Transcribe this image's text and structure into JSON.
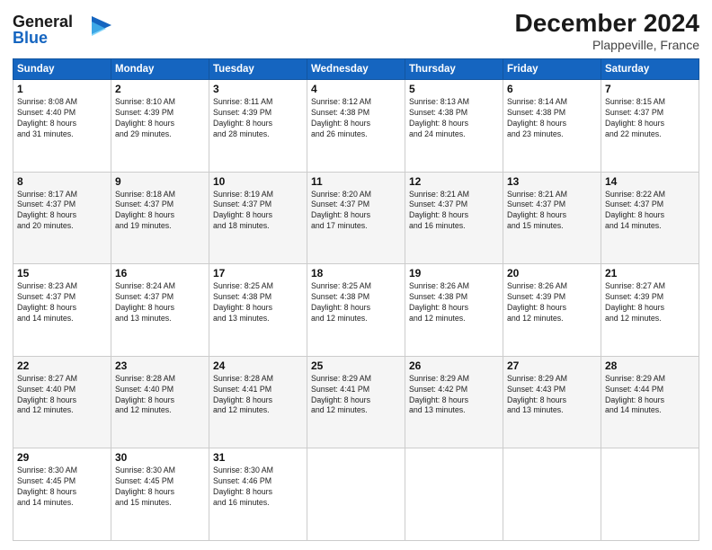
{
  "header": {
    "logo_line1": "General",
    "logo_line2": "Blue",
    "month": "December 2024",
    "location": "Plappeville, France"
  },
  "weekdays": [
    "Sunday",
    "Monday",
    "Tuesday",
    "Wednesday",
    "Thursday",
    "Friday",
    "Saturday"
  ],
  "weeks": [
    [
      {
        "day": "1",
        "info": "Sunrise: 8:08 AM\nSunset: 4:40 PM\nDaylight: 8 hours\nand 31 minutes."
      },
      {
        "day": "2",
        "info": "Sunrise: 8:10 AM\nSunset: 4:39 PM\nDaylight: 8 hours\nand 29 minutes."
      },
      {
        "day": "3",
        "info": "Sunrise: 8:11 AM\nSunset: 4:39 PM\nDaylight: 8 hours\nand 28 minutes."
      },
      {
        "day": "4",
        "info": "Sunrise: 8:12 AM\nSunset: 4:38 PM\nDaylight: 8 hours\nand 26 minutes."
      },
      {
        "day": "5",
        "info": "Sunrise: 8:13 AM\nSunset: 4:38 PM\nDaylight: 8 hours\nand 24 minutes."
      },
      {
        "day": "6",
        "info": "Sunrise: 8:14 AM\nSunset: 4:38 PM\nDaylight: 8 hours\nand 23 minutes."
      },
      {
        "day": "7",
        "info": "Sunrise: 8:15 AM\nSunset: 4:37 PM\nDaylight: 8 hours\nand 22 minutes."
      }
    ],
    [
      {
        "day": "8",
        "info": "Sunrise: 8:17 AM\nSunset: 4:37 PM\nDaylight: 8 hours\nand 20 minutes."
      },
      {
        "day": "9",
        "info": "Sunrise: 8:18 AM\nSunset: 4:37 PM\nDaylight: 8 hours\nand 19 minutes."
      },
      {
        "day": "10",
        "info": "Sunrise: 8:19 AM\nSunset: 4:37 PM\nDaylight: 8 hours\nand 18 minutes."
      },
      {
        "day": "11",
        "info": "Sunrise: 8:20 AM\nSunset: 4:37 PM\nDaylight: 8 hours\nand 17 minutes."
      },
      {
        "day": "12",
        "info": "Sunrise: 8:21 AM\nSunset: 4:37 PM\nDaylight: 8 hours\nand 16 minutes."
      },
      {
        "day": "13",
        "info": "Sunrise: 8:21 AM\nSunset: 4:37 PM\nDaylight: 8 hours\nand 15 minutes."
      },
      {
        "day": "14",
        "info": "Sunrise: 8:22 AM\nSunset: 4:37 PM\nDaylight: 8 hours\nand 14 minutes."
      }
    ],
    [
      {
        "day": "15",
        "info": "Sunrise: 8:23 AM\nSunset: 4:37 PM\nDaylight: 8 hours\nand 14 minutes."
      },
      {
        "day": "16",
        "info": "Sunrise: 8:24 AM\nSunset: 4:37 PM\nDaylight: 8 hours\nand 13 minutes."
      },
      {
        "day": "17",
        "info": "Sunrise: 8:25 AM\nSunset: 4:38 PM\nDaylight: 8 hours\nand 13 minutes."
      },
      {
        "day": "18",
        "info": "Sunrise: 8:25 AM\nSunset: 4:38 PM\nDaylight: 8 hours\nand 12 minutes."
      },
      {
        "day": "19",
        "info": "Sunrise: 8:26 AM\nSunset: 4:38 PM\nDaylight: 8 hours\nand 12 minutes."
      },
      {
        "day": "20",
        "info": "Sunrise: 8:26 AM\nSunset: 4:39 PM\nDaylight: 8 hours\nand 12 minutes."
      },
      {
        "day": "21",
        "info": "Sunrise: 8:27 AM\nSunset: 4:39 PM\nDaylight: 8 hours\nand 12 minutes."
      }
    ],
    [
      {
        "day": "22",
        "info": "Sunrise: 8:27 AM\nSunset: 4:40 PM\nDaylight: 8 hours\nand 12 minutes."
      },
      {
        "day": "23",
        "info": "Sunrise: 8:28 AM\nSunset: 4:40 PM\nDaylight: 8 hours\nand 12 minutes."
      },
      {
        "day": "24",
        "info": "Sunrise: 8:28 AM\nSunset: 4:41 PM\nDaylight: 8 hours\nand 12 minutes."
      },
      {
        "day": "25",
        "info": "Sunrise: 8:29 AM\nSunset: 4:41 PM\nDaylight: 8 hours\nand 12 minutes."
      },
      {
        "day": "26",
        "info": "Sunrise: 8:29 AM\nSunset: 4:42 PM\nDaylight: 8 hours\nand 13 minutes."
      },
      {
        "day": "27",
        "info": "Sunrise: 8:29 AM\nSunset: 4:43 PM\nDaylight: 8 hours\nand 13 minutes."
      },
      {
        "day": "28",
        "info": "Sunrise: 8:29 AM\nSunset: 4:44 PM\nDaylight: 8 hours\nand 14 minutes."
      }
    ],
    [
      {
        "day": "29",
        "info": "Sunrise: 8:30 AM\nSunset: 4:45 PM\nDaylight: 8 hours\nand 14 minutes."
      },
      {
        "day": "30",
        "info": "Sunrise: 8:30 AM\nSunset: 4:45 PM\nDaylight: 8 hours\nand 15 minutes."
      },
      {
        "day": "31",
        "info": "Sunrise: 8:30 AM\nSunset: 4:46 PM\nDaylight: 8 hours\nand 16 minutes."
      },
      null,
      null,
      null,
      null
    ]
  ]
}
